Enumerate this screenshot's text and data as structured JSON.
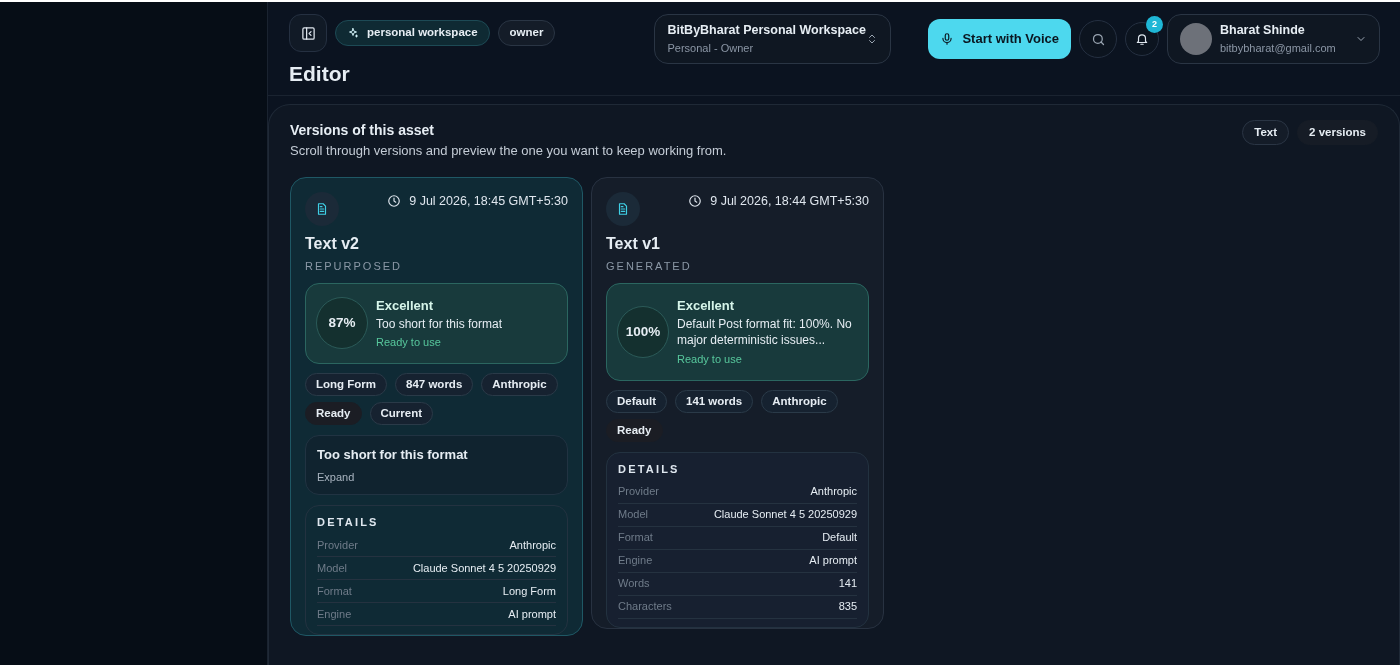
{
  "header": {
    "workspace_chip": "personal workspace",
    "role_chip": "owner",
    "title": "Editor",
    "workspace_switcher": {
      "name": "BitByBharat Personal Workspace",
      "subtitle": "Personal - Owner"
    },
    "voice_button": "Start with Voice",
    "notification_count": "2",
    "user": {
      "name": "Bharat Shinde",
      "email": "bitbybharat@gmail.com"
    }
  },
  "versions_panel": {
    "title": "Versions of this asset",
    "subtitle": "Scroll through versions and preview the one you want to keep working from.",
    "chips": [
      "Text",
      "2 versions"
    ],
    "versions": [
      {
        "selected": true,
        "timestamp": "9 Jul 2026, 18:45 GMT+5:30",
        "title": "Text v2",
        "origin": "REPURPOSED",
        "score": {
          "percent": "87%",
          "label": "Excellent",
          "message": "Too short for this format",
          "status": "Ready to use"
        },
        "tags": [
          {
            "text": "Long Form",
            "kind": "plain"
          },
          {
            "text": "847 words",
            "kind": "plain"
          },
          {
            "text": "Anthropic",
            "kind": "plain"
          },
          {
            "text": "Ready",
            "kind": "status"
          },
          {
            "text": "Current",
            "kind": "plain"
          }
        ],
        "note": {
          "title": "Too short for this format",
          "action": "Expand"
        },
        "details": {
          "heading": "DETAILS",
          "rows": [
            {
              "label": "Provider",
              "value": "Anthropic"
            },
            {
              "label": "Model",
              "value": "Claude Sonnet 4 5 20250929"
            },
            {
              "label": "Format",
              "value": "Long Form"
            },
            {
              "label": "Engine",
              "value": "AI prompt"
            }
          ]
        }
      },
      {
        "selected": false,
        "timestamp": "9 Jul 2026, 18:44 GMT+5:30",
        "title": "Text v1",
        "origin": "GENERATED",
        "score": {
          "percent": "100%",
          "label": "Excellent",
          "message": "Default Post format fit: 100%. No major deterministic issues...",
          "status": "Ready to use"
        },
        "tags": [
          {
            "text": "Default",
            "kind": "plain"
          },
          {
            "text": "141 words",
            "kind": "plain"
          },
          {
            "text": "Anthropic",
            "kind": "plain"
          },
          {
            "text": "Ready",
            "kind": "status"
          }
        ],
        "details": {
          "heading": "DETAILS",
          "rows": [
            {
              "label": "Provider",
              "value": "Anthropic"
            },
            {
              "label": "Model",
              "value": "Claude Sonnet 4 5 20250929"
            },
            {
              "label": "Format",
              "value": "Default"
            },
            {
              "label": "Engine",
              "value": "AI prompt"
            },
            {
              "label": "Words",
              "value": "141"
            },
            {
              "label": "Characters",
              "value": "835"
            }
          ]
        }
      }
    ]
  }
}
